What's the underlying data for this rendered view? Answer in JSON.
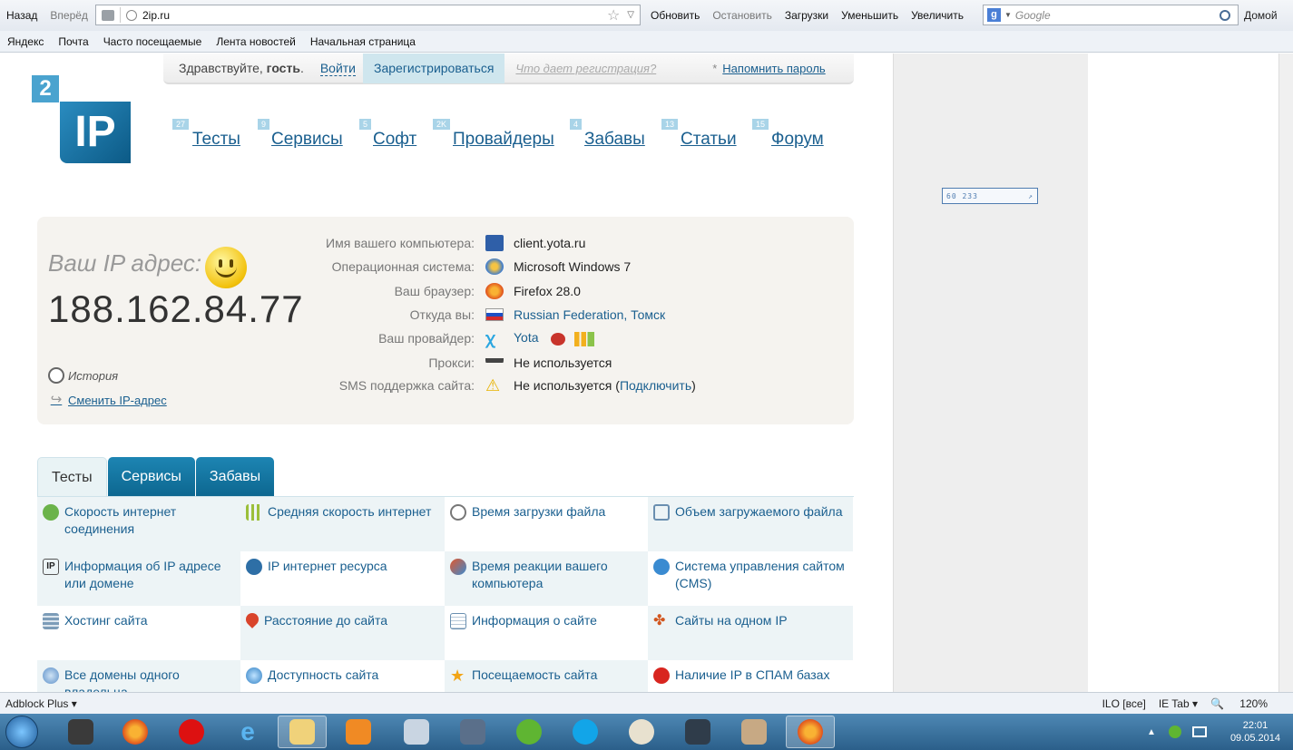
{
  "browser": {
    "back": "Назад",
    "forward": "Вперёд",
    "url": "2ip.ru",
    "refresh": "Обновить",
    "stop": "Остановить",
    "downloads": "Загрузки",
    "zoom_out": "Уменьшить",
    "zoom_in": "Увеличить",
    "search_placeholder": "Google",
    "home": "Домой"
  },
  "bookmarks": [
    "Яндекс",
    "Почта",
    "Часто посещаемые",
    "Лента новостей",
    "Начальная страница"
  ],
  "loginbar": {
    "hello": "Здравствуйте,",
    "guest": "гость",
    "login": "Войти",
    "register": "Зарегистрироваться",
    "what": "Что дает регистрация?",
    "asterisk": "*",
    "remind": "Напомнить пароль"
  },
  "logo": {
    "two": "2",
    "ip": "IP"
  },
  "nav": [
    {
      "badge": "27",
      "label": "Тесты"
    },
    {
      "badge": "9",
      "label": "Сервисы"
    },
    {
      "badge": "5",
      "label": "Софт"
    },
    {
      "badge": "2K",
      "label": "Провайдеры"
    },
    {
      "badge": "4",
      "label": "Забавы"
    },
    {
      "badge": "13",
      "label": "Статьи"
    },
    {
      "badge": "15",
      "label": "Форум"
    }
  ],
  "counter": "60 233",
  "ip_panel": {
    "label": "Ваш IP адрес:",
    "ip": "188.162.84.77",
    "history": "История",
    "change": "Сменить IP-адрес",
    "rows": [
      {
        "key": "Имя вашего компьютера:",
        "value": "client.yota.ru",
        "icon": "computer-icon"
      },
      {
        "key": "Операционная система:",
        "value": "Microsoft Windows 7",
        "icon": "windows-icon"
      },
      {
        "key": "Ваш браузер:",
        "value": "Firefox 28.0",
        "icon": "firefox-icon"
      },
      {
        "key": "Откуда вы:",
        "value": "Russian Federation, Томск",
        "icon": "russia-flag-icon"
      },
      {
        "key": "Ваш провайдер:",
        "value": "Yota",
        "icon": "yota-icon"
      },
      {
        "key": "Прокси:",
        "value": "Не используется",
        "icon": "glasses-icon"
      },
      {
        "key": "SMS поддержка сайта:",
        "value": "Не используется (",
        "link": "Подключить",
        "suffix": ")",
        "icon": "warning-icon"
      }
    ]
  },
  "tabs": [
    "Тесты",
    "Сервисы",
    "Забавы"
  ],
  "tests": [
    [
      "Скорость интернет соединения",
      "Средняя скорость интернет",
      "Время загрузки файла",
      "Объем загружаемого файла"
    ],
    [
      "Информация об IP адресе или домене",
      "IP интернет ресурса",
      "Время реакции вашего компьютера",
      "Система управления сайтом (CMS)"
    ],
    [
      "Хостинг сайта",
      "Расстояние до сайта",
      "Информация о сайте",
      "Сайты на одном IP"
    ],
    [
      "Все домены одного владельца",
      "Доступность сайта",
      "Посещаемость сайта",
      "Наличие IP в СПАМ базах"
    ]
  ],
  "statusbar": {
    "adblock": "Adblock Plus ▾",
    "ilo": "ILO [все]",
    "ietab": "IE Tab ▾",
    "zoom": "120%"
  },
  "taskbar": {
    "time": "22:01",
    "date": "09.05.2014"
  }
}
